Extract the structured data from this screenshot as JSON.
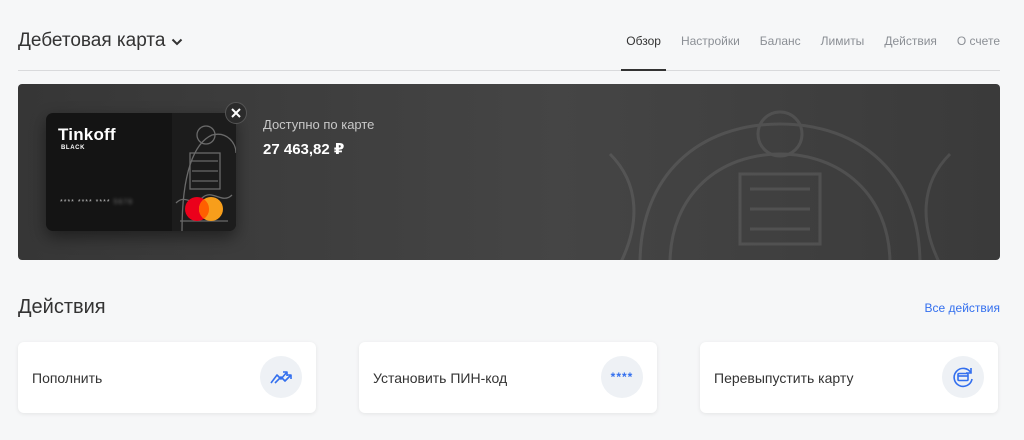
{
  "header": {
    "title": "Дебетовая карта",
    "tabs": [
      {
        "label": "Обзор",
        "active": true
      },
      {
        "label": "Настройки",
        "active": false
      },
      {
        "label": "Баланс",
        "active": false
      },
      {
        "label": "Лимиты",
        "active": false
      },
      {
        "label": "Действия",
        "active": false
      },
      {
        "label": "О счете",
        "active": false
      }
    ]
  },
  "card": {
    "brand": "Tinkoff",
    "tier": "BLACK",
    "masked_number": "**** **** ****",
    "masked_tail": "5678",
    "available_label": "Доступно по карте",
    "available_amount": "27 463,82 ₽"
  },
  "actions": {
    "title": "Действия",
    "all_link": "Все действия",
    "items": [
      {
        "label": "Пополнить",
        "icon": "transfer-arrows-icon"
      },
      {
        "label": "Установить ПИН-код",
        "icon": "pin-stars-icon",
        "icon_text": "****"
      },
      {
        "label": "Перевыпустить карту",
        "icon": "card-reissue-icon"
      }
    ]
  },
  "colors": {
    "accent": "#336fee",
    "panel": "#3f3f3f",
    "background": "#f6f7f8"
  }
}
